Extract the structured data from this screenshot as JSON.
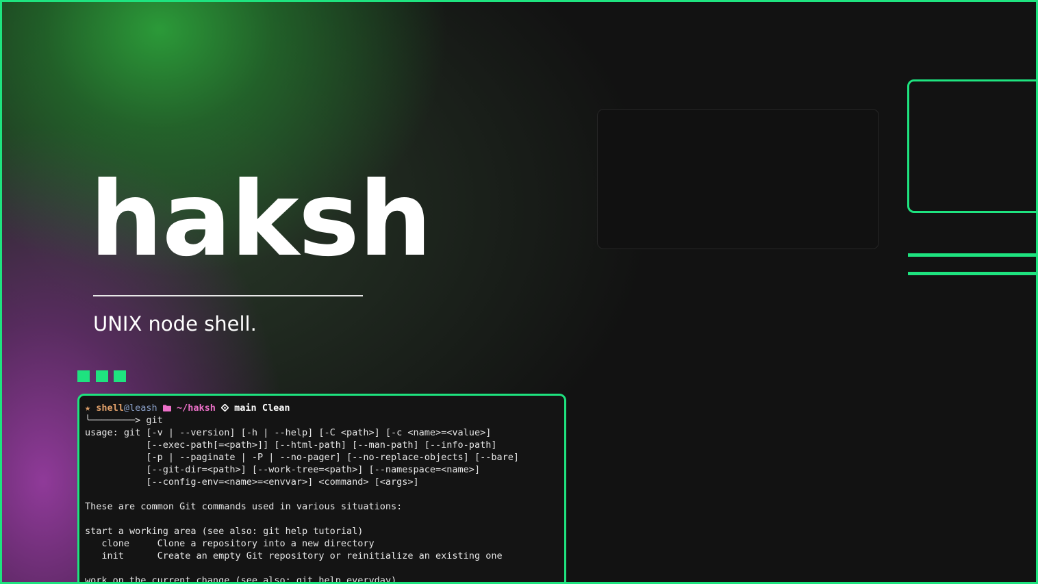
{
  "hero": {
    "title": "haksh",
    "subtitle": "UNIX node shell."
  },
  "colors": {
    "accent": "#1ee37f",
    "background": "#121212",
    "gradient_green": "#2ca03a",
    "gradient_purple": "#963ca0",
    "prompt_user": "#e0a06a",
    "prompt_path": "#ec70c8"
  },
  "terminal": {
    "prompt": {
      "star_icon": "★",
      "user": "shell",
      "host": "@leash",
      "folder_icon": "folder-icon",
      "path": "~/haksh",
      "branch_icon": "git-branch-icon",
      "branch": "main",
      "status": "Clean",
      "arrow": "╰────────> ",
      "command": "git"
    },
    "output": [
      "usage: git [-v | --version] [-h | --help] [-C <path>] [-c <name>=<value>]",
      "           [--exec-path[=<path>]] [--html-path] [--man-path] [--info-path]",
      "           [-p | --paginate | -P | --no-pager] [--no-replace-objects] [--bare]",
      "           [--git-dir=<path>] [--work-tree=<path>] [--namespace=<name>]",
      "           [--config-env=<name>=<envvar>] <command> [<args>]",
      "",
      "These are common Git commands used in various situations:",
      "",
      "start a working area (see also: git help tutorial)",
      "   clone     Clone a repository into a new directory",
      "   init      Create an empty Git repository or reinitialize an existing one",
      "",
      "work on the current change (see also: git help everyday)"
    ]
  }
}
